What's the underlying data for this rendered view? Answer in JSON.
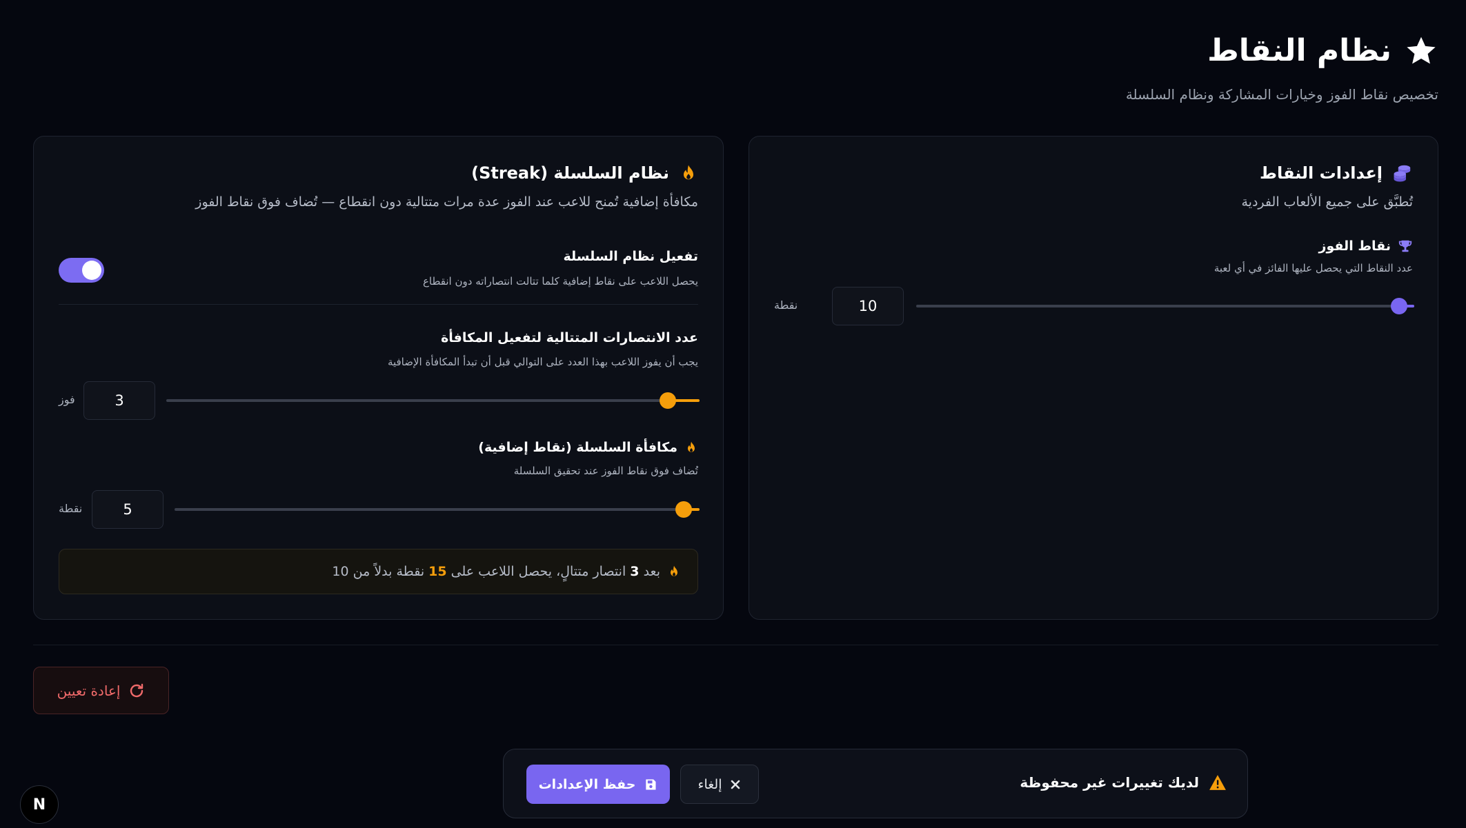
{
  "header": {
    "title": "نظام النقاط",
    "subtitle": "تخصيص نقاط الفوز وخيارات المشاركة ونظام السلسلة"
  },
  "points_card": {
    "title": "إعدادات النقاط",
    "description": "تُطبَّق على جميع الألعاب الفردية",
    "win_points": {
      "label": "نقاط الفوز",
      "description": "عدد النقاط التي يحصل عليها الفائز في أي لعبة",
      "value": "10",
      "unit": "نقطة",
      "fraction": 0.97
    }
  },
  "streak_card": {
    "title": "نظام السلسلة (Streak)",
    "description": "مكافأة إضافية تُمنح للاعب عند الفوز عدة مرات متتالية دون انقطاع — تُضاف فوق نقاط الفوز",
    "toggle": {
      "label": "تفعيل نظام السلسلة",
      "description": "يحصل اللاعب على نقاط إضافية كلما تتالت انتصاراته دون انقطاع",
      "enabled": true
    },
    "consecutive": {
      "label": "عدد الانتصارات المتتالية لتفعيل المكافأة",
      "description": "يجب أن يفوز اللاعب بهذا العدد على التوالي قبل أن تبدأ المكافأة الإضافية",
      "value": "3",
      "unit": "فوز",
      "fraction": 0.94
    },
    "bonus": {
      "label": "مكافأة السلسلة (نقاط إضافية)",
      "description": "تُضاف فوق نقاط الفوز عند تحقيق السلسلة",
      "value": "5",
      "unit": "نقطة",
      "fraction": 0.97
    },
    "summary": {
      "p1": "بعد",
      "wins": "3",
      "p2": "انتصار متتالٍ، يحصل اللاعب على",
      "total": "15",
      "p3": "نقطة بدلاً من 10"
    }
  },
  "actions": {
    "reset_label": "إعادة تعيين"
  },
  "save_bar": {
    "message": "لديك تغييرات غير محفوظة",
    "cancel_label": "إلغاء",
    "save_label": "حفظ الإعدادات"
  },
  "badge": {
    "letter": "N"
  },
  "colors": {
    "accent_purple": "#7966f0",
    "accent_orange": "#f59e0b",
    "danger": "#f06a6a",
    "background": "#05070f"
  },
  "icons": [
    "star-icon",
    "coins-icon",
    "trophy-icon",
    "flame-icon",
    "refresh-icon",
    "warning-icon",
    "close-icon",
    "save-icon"
  ]
}
